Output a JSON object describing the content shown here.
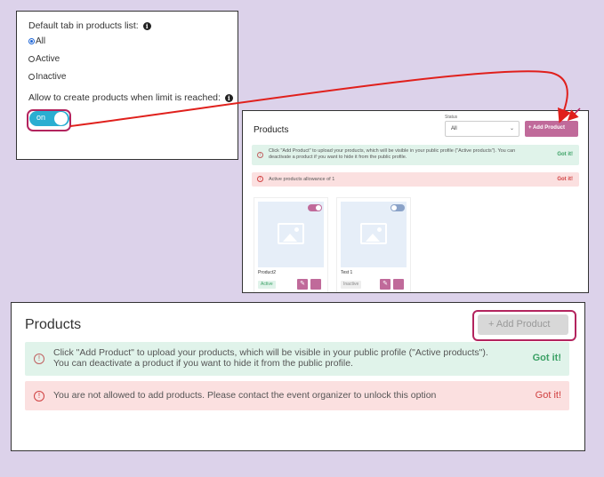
{
  "settings": {
    "default_tab_label": "Default tab in products list:",
    "options": [
      {
        "label": "All",
        "checked": true
      },
      {
        "label": "Active",
        "checked": false
      },
      {
        "label": "Inactive",
        "checked": false
      }
    ],
    "allow_label": "Allow to create products when limit is reached:",
    "toggle_label": "on",
    "info_icon": "i"
  },
  "small_products": {
    "title": "Products",
    "status_label": "Status",
    "status_value": "All",
    "add_button": "+ Add Product",
    "info_alert": "Click \"Add Product\" to upload your products, which will be visible in your public profile (\"Active products\"). You can deactivate a product if you want to hide it from the public profile.",
    "info_got": "Got it!",
    "allowance_alert": "Active products allowance of 1",
    "allowance_got": "Got it!",
    "cards": [
      {
        "name": "Product2",
        "status": "Active",
        "enabled": true
      },
      {
        "name": "Test 1",
        "status": "Inactive",
        "enabled": false
      }
    ]
  },
  "large_products": {
    "title": "Products",
    "add_button": "+ Add Product",
    "info_alert": "Click \"Add Product\" to upload your products, which will be visible in your public profile (\"Active products\"). You can deactivate a product if you want to hide it from the public profile.",
    "info_got": "Got it!",
    "error_alert": "You are not allowed to add products. Please contact the event organizer to unlock this option",
    "error_got": "Got it!"
  },
  "colors": {
    "background": "#dcd2ea",
    "accent": "#c06a9a",
    "highlight": "#b3245e",
    "toggle_on": "#2aaed1",
    "arrow": "#e0201c"
  }
}
